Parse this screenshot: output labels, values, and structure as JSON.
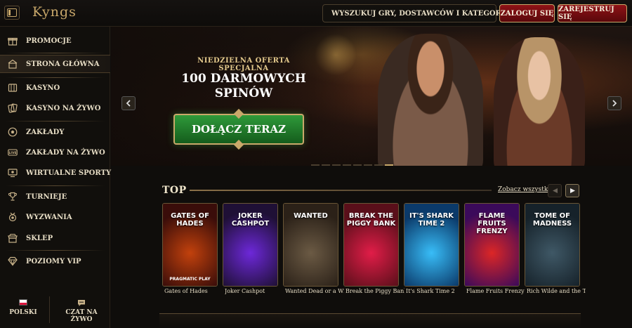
{
  "header": {
    "logo": "Kyngs",
    "search_label": "WYSZUKUJ GRY, DOSTAWCÓW I KATEGORIE",
    "login_label": "ZALOGUJ SIĘ",
    "register_label": "ZAREJESTRUJ SIĘ"
  },
  "sidebar": {
    "items": [
      {
        "label": "PROMOCJE",
        "icon": "gift-icon"
      },
      {
        "label": "STRONA GŁÓWNA",
        "icon": "home-icon",
        "active": true
      },
      {
        "label": "KASYNO",
        "icon": "casino-icon"
      },
      {
        "label": "KASYNO NA ŻYWO",
        "icon": "cards-icon"
      },
      {
        "label": "ZAKŁADY",
        "icon": "soccer-ball-icon"
      },
      {
        "label": "ZAKŁADY NA ŻYWO",
        "icon": "live-icon"
      },
      {
        "label": "WIRTUALNE SPORTY",
        "icon": "monitor-icon"
      },
      {
        "label": "TURNIEJE",
        "icon": "trophy-icon"
      },
      {
        "label": "WYZWANIA",
        "icon": "medal-icon"
      },
      {
        "label": "SKLEP",
        "icon": "shop-icon"
      },
      {
        "label": "POZIOMY VIP",
        "icon": "diamond-icon"
      }
    ],
    "footer": {
      "language_label": "POLSKI",
      "chat_label": "CZAT NA ŻYWO"
    }
  },
  "hero": {
    "kicker": "NIEDZIELNA OFERTA SPECJALNA",
    "title_line1": "100 DARMOWYCH",
    "title_line2": "SPINÓW",
    "cta_label": "DOŁĄCZ TERAZ",
    "slides_count": 8,
    "active_slide": 7
  },
  "top_section": {
    "title": "TOP",
    "see_all_label": "Zobacz wszystko",
    "games": [
      {
        "name": "Gates of Hades",
        "art_title": "GATES OF HADES",
        "provider": "PRAGMATIC PLAY",
        "colors": [
          "#3a0d0a",
          "#c2410c"
        ]
      },
      {
        "name": "Joker Cashpot",
        "art_title": "JOKER CASHPOT",
        "provider": "",
        "colors": [
          "#1f1036",
          "#6d28d9"
        ]
      },
      {
        "name": "Wanted Dead or a Wild",
        "art_title": "WANTED",
        "provider": "",
        "colors": [
          "#2b2118",
          "#6b5a44"
        ]
      },
      {
        "name": "Break the Piggy Bank",
        "art_title": "BREAK THE PIGGY BANK",
        "provider": "",
        "colors": [
          "#5a0f1a",
          "#e11d48"
        ]
      },
      {
        "name": "It's Shark Time 2",
        "art_title": "IT'S SHARK TIME 2",
        "provider": "",
        "colors": [
          "#0b3a6a",
          "#38bdf8"
        ]
      },
      {
        "name": "Flame Fruits Frenzy",
        "art_title": "FLAME FRUITS FRENZY",
        "provider": "",
        "colors": [
          "#3b0a5a",
          "#dc2626"
        ]
      },
      {
        "name": "Rich Wilde and the Tome of Madness",
        "art_title": "TOME OF MADNESS",
        "provider": "",
        "colors": [
          "#16222a",
          "#3f5866"
        ]
      }
    ]
  },
  "colors": {
    "gold": "#c9a86a",
    "red_button": "#8e1216",
    "green_cta": "#2f9a3a",
    "background": "#0f0d0b"
  }
}
